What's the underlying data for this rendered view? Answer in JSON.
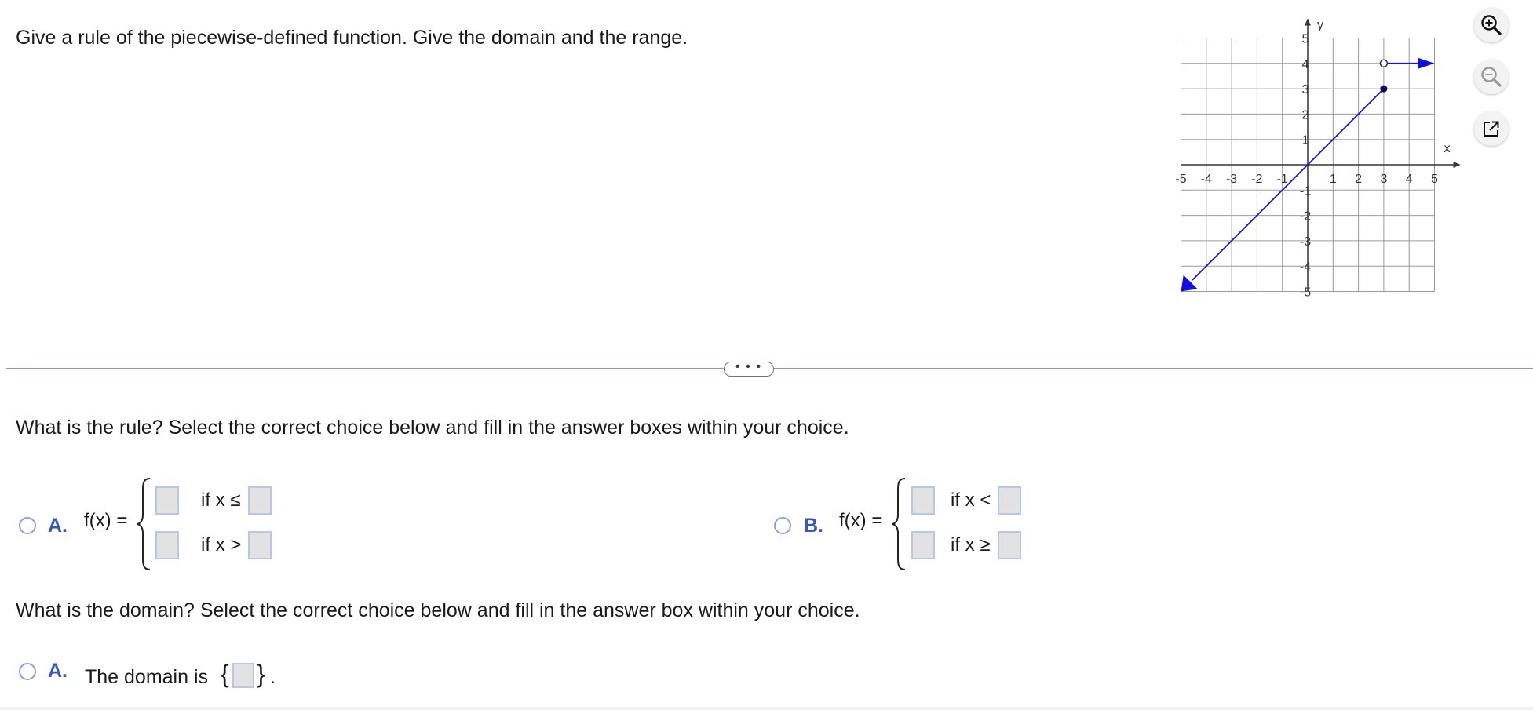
{
  "question": {
    "prompt": "Give a rule of the piecewise-defined function. Give the domain and the range."
  },
  "graph": {
    "x_axis_label": "x",
    "y_axis_label": "y",
    "x_ticks": [
      "-5",
      "-4",
      "-3",
      "-2",
      "-1",
      "1",
      "2",
      "3",
      "4",
      "5"
    ],
    "y_ticks": [
      "5",
      "4",
      "3",
      "2",
      "1",
      "-1",
      "-2",
      "-3",
      "-4",
      "-5"
    ],
    "line_color": "#1010e0",
    "grid_color": "#9a9a9a",
    "segment_1": "y = x for x ≤ 3, arrow toward bottom-left, closed dot at (3, 3)",
    "segment_2": "y = 4 for x > 3, open circle at (3, 4), arrow to the right"
  },
  "tools": {
    "zoom_in_icon": "zoom-in-icon",
    "zoom_out_icon": "zoom-out-icon",
    "popout_icon": "popout-icon"
  },
  "divider": {
    "more_label": "• • •"
  },
  "rule_question": {
    "prompt": "What is the rule? Select the correct choice below and fill in the answer boxes within your choice.",
    "choice_a": {
      "letter": "A.",
      "func": "f(x) =",
      "cond_1": "if x ≤",
      "cond_2": "if x >"
    },
    "choice_b": {
      "letter": "B.",
      "func": "f(x) =",
      "cond_1": "if x <",
      "cond_2": "if x ≥"
    }
  },
  "domain_question": {
    "prompt": "What is the domain? Select the correct choice below and fill in the answer box within your choice.",
    "choice_a": {
      "letter": "A.",
      "text": "The domain is",
      "open_brace": "{",
      "close_brace": "}",
      "period": "."
    }
  },
  "colors": {
    "accent": "#3b57b4",
    "radio_border": "#8ea0d6",
    "box_border": "#b7c8e6",
    "box_fill": "#e2e2e2",
    "divider": "#b48a98"
  }
}
